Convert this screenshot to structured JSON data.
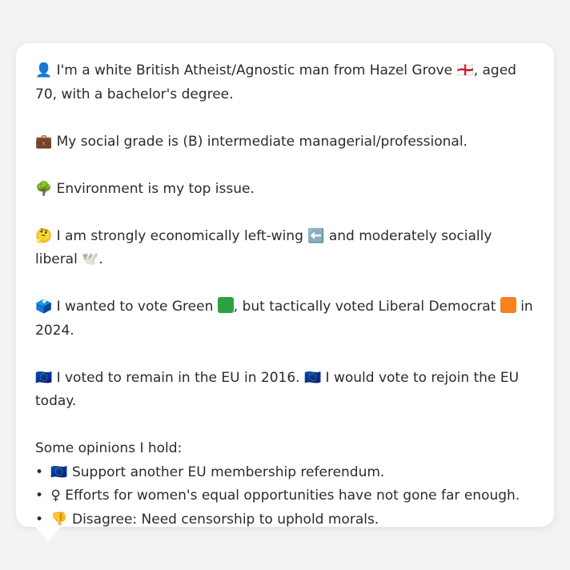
{
  "profile": {
    "identity": {
      "icon": "👤",
      "text_a": "I'm a white British Atheist/Agnostic man from Hazel Grove",
      "flag": "🏴󠁧󠁢󠁥󠁮󠁧󠁿",
      "text_b": ", aged 70, with a bachelor's degree."
    },
    "social": {
      "icon": "💼",
      "text": "My social grade is (B) intermediate managerial/professional."
    },
    "issue": {
      "icon": "🌳",
      "text": "Environment is my top issue."
    },
    "ideology": {
      "icon": "🤔",
      "text_a": "I am strongly economically left-wing",
      "left_icon": "⬅️",
      "text_b": "and moderately socially liberal",
      "dove_icon": "🕊️",
      "text_c": "."
    },
    "vote": {
      "icon": "🗳️",
      "text_a": "I wanted to vote Green",
      "text_b": ", but tactically voted Liberal Democrat",
      "text_c": "in 2024.",
      "green_color": "#2ea043",
      "libdem_color": "#f5821f"
    },
    "eu": {
      "icon": "🇪🇺",
      "text_a": "I voted to remain in the EU in 2016.",
      "icon_b": "🇪🇺",
      "text_b": "I would vote to rejoin the EU today."
    }
  },
  "opinions": {
    "heading": "Some opinions I hold:",
    "items": [
      {
        "icon": "🇪🇺",
        "text": "Support another EU membership referendum."
      },
      {
        "icon": "♀",
        "text": "Efforts for women's equal opportunities have not gone far enough."
      },
      {
        "icon": "👎",
        "text": "Disagree: Need censorship to uphold morals."
      }
    ]
  }
}
